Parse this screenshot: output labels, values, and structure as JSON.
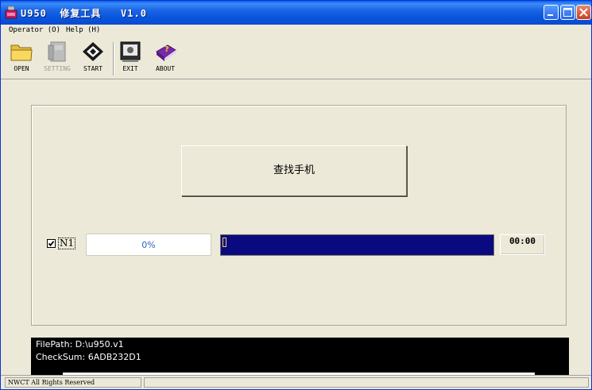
{
  "window": {
    "title": "U950  修复工具   V1.0"
  },
  "menu": {
    "items": [
      {
        "label": "Operator (O)"
      },
      {
        "label": "Help (H)"
      }
    ]
  },
  "toolbar": {
    "open_label": "OPEN",
    "setting_label": "SETTING",
    "start_label": "START",
    "exit_label": "EXIT",
    "about_label": "ABOUT"
  },
  "main": {
    "search_button_label": "查找手机",
    "device": {
      "checkbox_label": "N1",
      "checked": true,
      "progress_text": "0%",
      "progress_fraction": 0,
      "timer": "00:00"
    }
  },
  "console": {
    "lines": [
      "FilePath: D:\\u950.v1",
      "CheckSum: 6ADB232D1"
    ]
  },
  "status": {
    "text": "NWCT All Rights Reserved"
  },
  "colors": {
    "progress_track": "#0a0a80",
    "titlebar": "#0856de",
    "console_bg": "#000000"
  }
}
